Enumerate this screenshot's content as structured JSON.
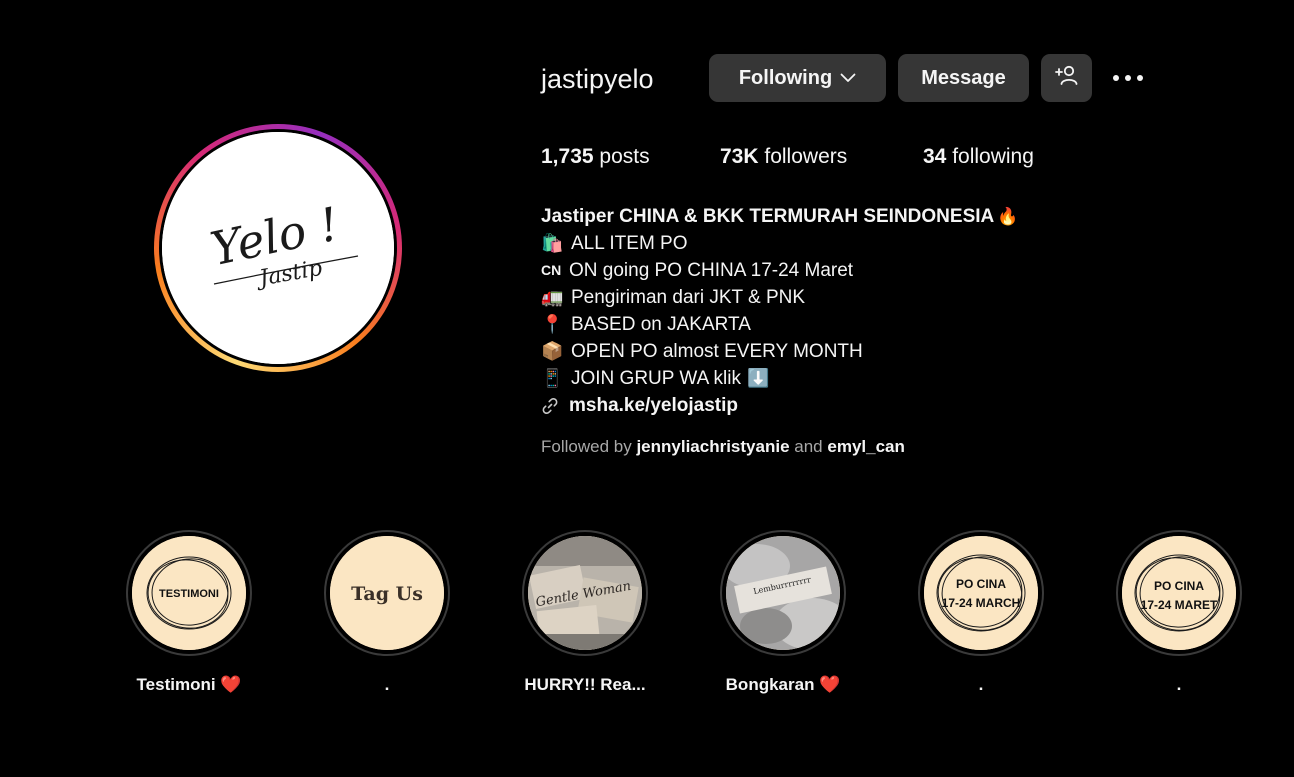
{
  "profile": {
    "username": "jastipyelo",
    "avatar_text_main": "Yelo !",
    "avatar_text_sub": "Jastip"
  },
  "actions": {
    "following_label": "Following",
    "message_label": "Message",
    "suggest_icon": "person-plus-icon",
    "more_icon": "more-options-icon"
  },
  "stats": {
    "posts_count": "1,735",
    "posts_label": "posts",
    "followers_count": "73K",
    "followers_label": "followers",
    "following_count": "34",
    "following_label": "following"
  },
  "bio": {
    "title": "Jastiper CHINA & BKK TERMURAH SEINDONESIA",
    "title_emoji": "🔥",
    "lines": [
      {
        "emoji": "🛍️",
        "text": "ALL ITEM PO"
      },
      {
        "emoji": "CN",
        "text": "ON going PO CHINA 17-24 Maret"
      },
      {
        "emoji": "🚛",
        "text": "Pengiriman dari JKT & PNK"
      },
      {
        "emoji": "📍",
        "text": "BASED on JAKARTA"
      },
      {
        "emoji": "📦",
        "text": "OPEN PO almost EVERY MONTH"
      },
      {
        "emoji": "📱",
        "text": "JOIN GRUP WA klik",
        "trail": "⬇️"
      }
    ],
    "link": "msha.ke/yelojastip",
    "link_icon": "link-icon"
  },
  "followed_by": {
    "prefix": "Followed by",
    "user1": "jennyliachristyanie",
    "conjunction": "and",
    "user2": "emyl_can"
  },
  "highlights": [
    {
      "label": "Testimoni ❤️",
      "cover_text": "TESTIMONI"
    },
    {
      "label": ".",
      "cover_text": "Tag Us"
    },
    {
      "label": "HURRY!! Rea...",
      "cover_text": "Gentle Woman"
    },
    {
      "label": "Bongkaran ❤️",
      "cover_text": "Lemburrrrrrrr"
    },
    {
      "label": ".",
      "cover_text": "PO CINA 17-24 MARCH"
    },
    {
      "label": ".",
      "cover_text": "PO CINA 17-24 MARET"
    }
  ],
  "colors": {
    "background": "#000000",
    "button": "#363636",
    "text": "#f5f5f5",
    "muted": "#a8a8a8",
    "highlight_cover": "#fbe6c3"
  }
}
